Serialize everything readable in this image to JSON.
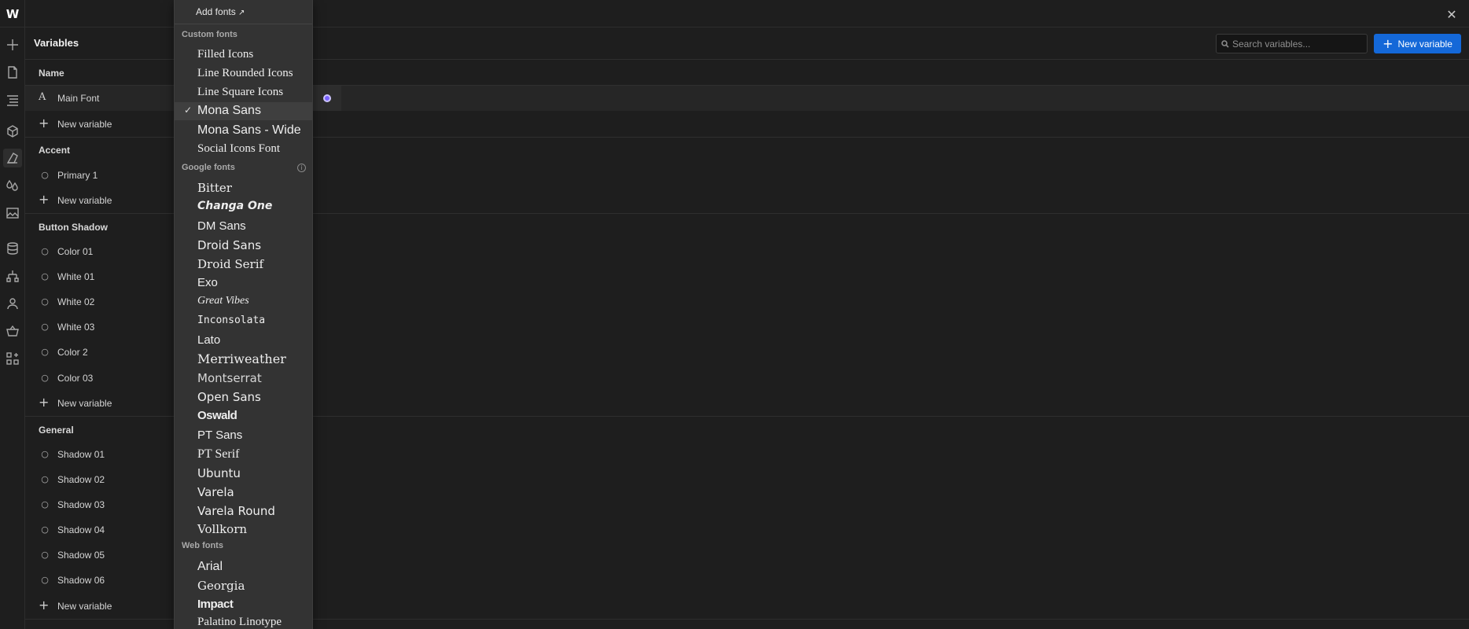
{
  "panel": {
    "title": "Variables",
    "column_name": "Name"
  },
  "search": {
    "placeholder": "Search variables..."
  },
  "actions": {
    "new_variable_label": "New variable"
  },
  "new_variable_row_label": "New variable",
  "groups": [
    {
      "name": "",
      "rows": [
        "Main Font"
      ]
    },
    {
      "name": "Accent",
      "rows": [
        "Primary 1"
      ]
    },
    {
      "name": "Button Shadow",
      "rows": [
        "Color 01",
        "White 01",
        "White 02",
        "White 03",
        "Color 2",
        "Color 03"
      ]
    },
    {
      "name": "General",
      "rows": [
        "Shadow 01",
        "Shadow 02",
        "Shadow 03",
        "Shadow 04",
        "Shadow 05",
        "Shadow 06"
      ]
    }
  ],
  "font_dropdown": {
    "add_fonts_label": "Add fonts",
    "selected": "Mona Sans",
    "sections": [
      {
        "title": "Custom fonts",
        "items": [
          "Filled Icons",
          "Line Rounded Icons",
          "Line Square Icons",
          "Mona Sans",
          "Mona Sans - Wide",
          "Social Icons Font"
        ]
      },
      {
        "title": "Google fonts",
        "items": [
          "Bitter",
          "Changa One",
          "DM Sans",
          "Droid Sans",
          "Droid Serif",
          "Exo",
          "Great Vibes",
          "Inconsolata",
          "Lato",
          "Merriweather",
          "Montserrat",
          "Open Sans",
          "Oswald",
          "PT Sans",
          "PT Serif",
          "Ubuntu",
          "Varela",
          "Varela Round",
          "Vollkorn"
        ]
      },
      {
        "title": "Web fonts",
        "items": [
          "Arial",
          "Georgia",
          "Impact",
          "Palatino Linotype"
        ]
      }
    ]
  },
  "colors": {
    "accent": "#1468d8",
    "indicator": "#7a63ff",
    "background": "#1e1e1e",
    "dropdown": "#333333"
  }
}
